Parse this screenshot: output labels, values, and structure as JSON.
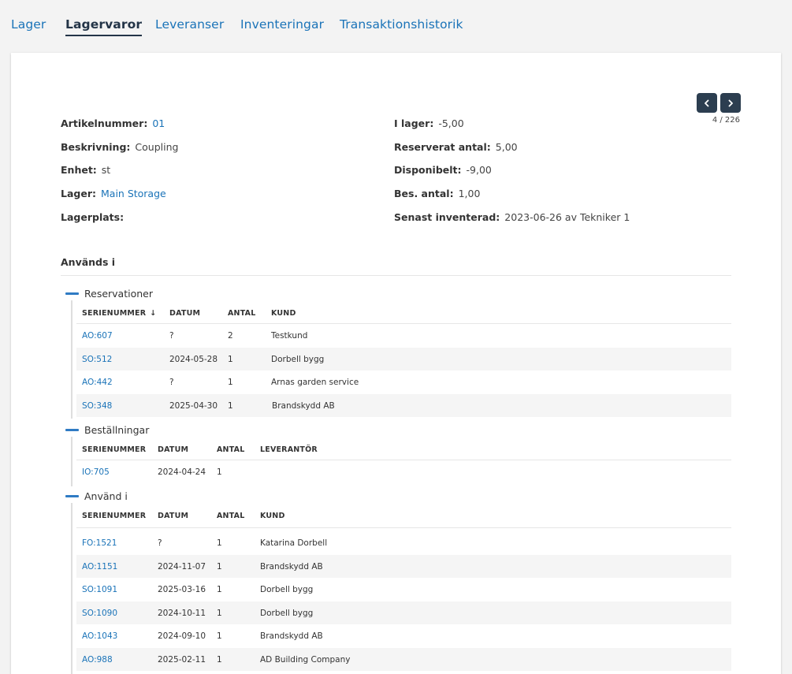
{
  "tabs": [
    {
      "label": "Lager",
      "active": false
    },
    {
      "label": "Lagervaror",
      "active": true
    },
    {
      "label": "Leveranser",
      "active": false
    },
    {
      "label": "Inventeringar",
      "active": false
    },
    {
      "label": "Transaktionshistorik",
      "active": false
    }
  ],
  "pager": {
    "count": "4 / 226",
    "prev_icon": "chevron-left-icon",
    "next_icon": "chevron-right-icon"
  },
  "details": {
    "left": [
      {
        "label": "Artikelnummer:",
        "value": "01",
        "link": true
      },
      {
        "label": "Beskrivning:",
        "value": "Coupling",
        "link": false
      },
      {
        "label": "Enhet:",
        "value": "st",
        "link": false
      },
      {
        "label": "Lager:",
        "value": "Main Storage",
        "link": true
      },
      {
        "label": "Lagerplats:",
        "value": "",
        "link": false
      }
    ],
    "right": [
      {
        "label": "I lager:",
        "value": "-5,00"
      },
      {
        "label": "Reserverat antal:",
        "value": "5,00"
      },
      {
        "label": "Disponibelt:",
        "value": "-9,00"
      },
      {
        "label": "Bes. antal:",
        "value": "1,00"
      },
      {
        "label": "Senast inventerad:",
        "value": "2023-06-26 av Tekniker 1"
      }
    ]
  },
  "used_in": {
    "title": "Används i",
    "groups": [
      {
        "name": "Reservationer",
        "columns": [
          "SERIENUMMER",
          "DATUM",
          "ANTAL",
          "KUND"
        ],
        "sort_icon": "↓",
        "rows": [
          [
            "AO:607",
            "?",
            "2",
            "Testkund"
          ],
          [
            "SO:512",
            "2024-05-28",
            "1",
            "Dorbell bygg"
          ],
          [
            "AO:442",
            "?",
            "1",
            "Arnas garden service"
          ],
          [
            "SO:348",
            "2025-04-30",
            "1",
            "Brandskydd AB"
          ]
        ]
      },
      {
        "name": "Beställningar",
        "columns": [
          "SERIENUMMER",
          "DATUM",
          "ANTAL",
          "LEVERANTÖR"
        ],
        "rows": [
          [
            "IO:705",
            "2024-04-24",
            "1",
            ""
          ]
        ]
      },
      {
        "name": "Använd i",
        "columns": [
          "SERIENUMMER",
          "DATUM",
          "ANTAL",
          "KUND"
        ],
        "rows": [
          [
            "FO:1521",
            "?",
            "1",
            "Katarina Dorbell"
          ],
          [
            "AO:1151",
            "2024-11-07",
            "1",
            "Brandskydd AB"
          ],
          [
            "SO:1091",
            "2025-03-16",
            "1",
            "Dorbell bygg"
          ],
          [
            "SO:1090",
            "2024-10-11",
            "1",
            "Dorbell bygg"
          ],
          [
            "AO:1043",
            "2024-09-10",
            "1",
            "Brandskydd AB"
          ],
          [
            "AO:988",
            "2025-02-11",
            "1",
            "AD Building Company"
          ]
        ]
      }
    ]
  }
}
